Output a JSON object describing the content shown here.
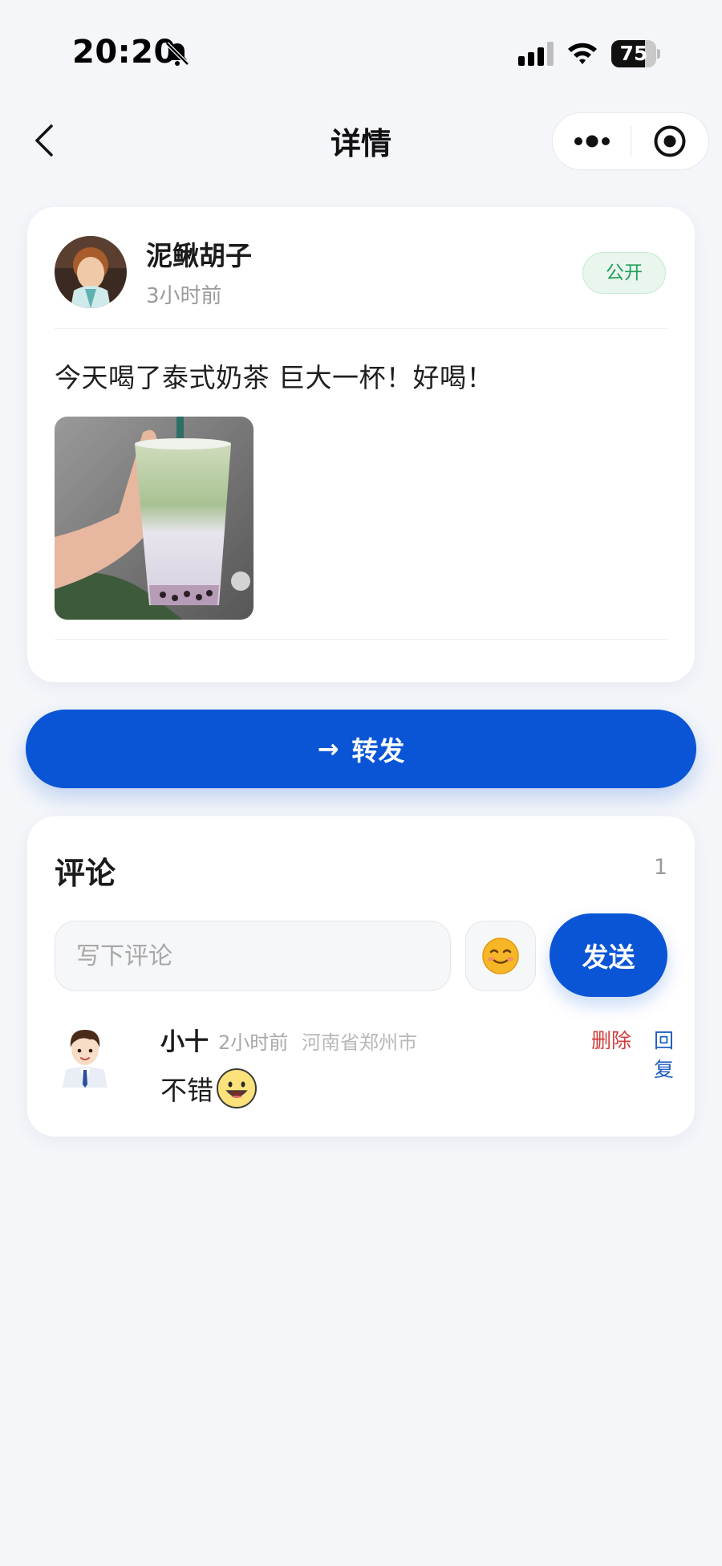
{
  "status_bar": {
    "time": "20:20",
    "battery": "75",
    "battery_level": 0.75,
    "icons": [
      "bell-muted-icon",
      "cellular-signal-icon",
      "wifi-icon",
      "battery-icon"
    ]
  },
  "nav": {
    "title": "详情",
    "icons": [
      "back-chevron-icon",
      "more-dots-icon",
      "target-icon"
    ]
  },
  "post": {
    "author": "泥鳅胡子",
    "time": "3小时前",
    "visibility": "公开",
    "text": "今天喝了泰式奶茶 巨大一杯！好喝！",
    "image_icon": "milk-tea-photo"
  },
  "forward": {
    "arrow": "→",
    "label": "转发"
  },
  "comments": {
    "title": "评论",
    "count": "1",
    "input_placeholder": "写下评论",
    "emoji_icon": "smiling-face-icon",
    "send_label": "发送",
    "items": [
      {
        "name": "小十",
        "time": "2小时前",
        "location": "河南省郑州市",
        "text": "不错",
        "emoji_icon": "grinning-face-icon",
        "delete_label": "删除",
        "reply_label": "回复"
      }
    ]
  },
  "colors": {
    "background": "#f4f6fa",
    "primary": "#0a55d6",
    "badge_green": "#22a05a",
    "delete_red": "#d23c3c",
    "reply_blue": "#1f5fbf"
  }
}
